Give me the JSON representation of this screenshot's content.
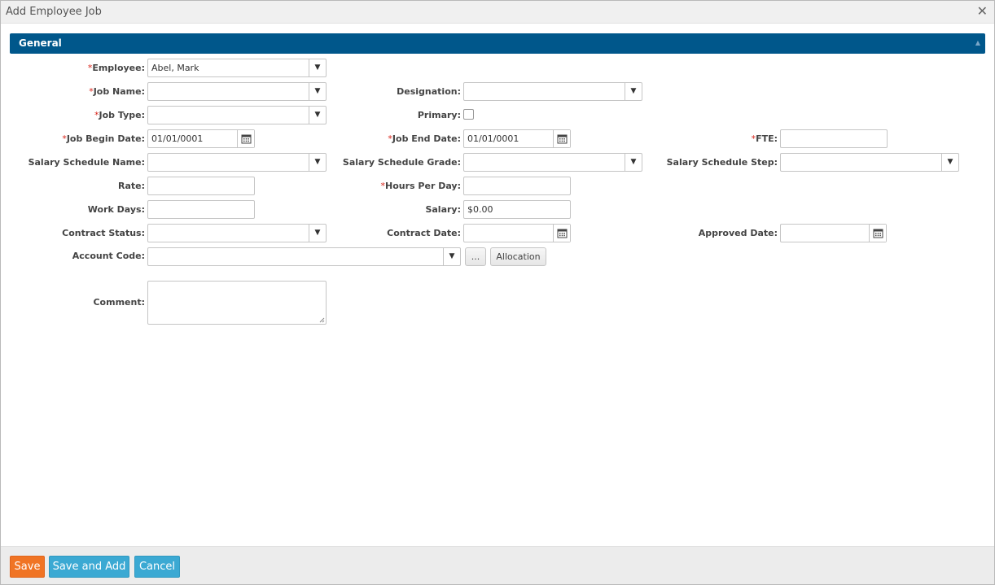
{
  "window": {
    "title": "Add Employee Job",
    "close_glyph": "✕"
  },
  "section": {
    "title": "General",
    "collapse_glyph": "▲"
  },
  "fields": {
    "employee": {
      "label": "Employee:",
      "required": "*",
      "value": "Abel, Mark"
    },
    "job_name": {
      "label": "Job Name:",
      "required": "*",
      "value": ""
    },
    "designation": {
      "label": "Designation:",
      "value": ""
    },
    "job_type": {
      "label": "Job Type:",
      "required": "*",
      "value": ""
    },
    "primary": {
      "label": "Primary:",
      "checked": false
    },
    "job_begin_date": {
      "label": "Job Begin Date:",
      "required": "*",
      "value": "01/01/0001"
    },
    "job_end_date": {
      "label": "Job End Date:",
      "required": "*",
      "value": "01/01/0001"
    },
    "fte": {
      "label": "FTE:",
      "required": "*",
      "value": ""
    },
    "salary_schedule_name": {
      "label": "Salary Schedule Name:",
      "value": ""
    },
    "salary_schedule_grade": {
      "label": "Salary Schedule Grade:",
      "value": ""
    },
    "salary_schedule_step": {
      "label": "Salary Schedule Step:",
      "value": ""
    },
    "rate": {
      "label": "Rate:",
      "value": ""
    },
    "hours_per_day": {
      "label": "Hours Per Day:",
      "required": "*",
      "value": ""
    },
    "work_days": {
      "label": "Work Days:",
      "value": ""
    },
    "salary": {
      "label": "Salary:",
      "value": "$0.00"
    },
    "contract_status": {
      "label": "Contract Status:",
      "value": ""
    },
    "contract_date": {
      "label": "Contract Date:",
      "value": ""
    },
    "approved_date": {
      "label": "Approved Date:",
      "value": ""
    },
    "account_code": {
      "label": "Account Code:",
      "value": "",
      "ellipsis_label": "...",
      "allocation_label": "Allocation"
    },
    "comment": {
      "label": "Comment:",
      "value": ""
    }
  },
  "footer": {
    "save_label": "Save",
    "save_and_add_label": "Save and Add",
    "cancel_label": "Cancel"
  },
  "colors": {
    "header_bg": "#00578b",
    "required": "#d9261c",
    "save_btn": "#f07424",
    "secondary_btn": "#3ba9d3"
  },
  "icons": {
    "dropdown": "chevron-down-icon",
    "calendar": "calendar-icon",
    "close": "close-icon",
    "collapse": "collapse-up-icon"
  }
}
